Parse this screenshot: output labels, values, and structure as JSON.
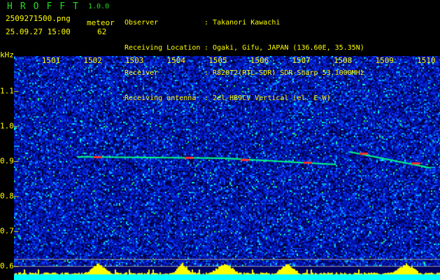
{
  "header": {
    "app": "HROFFT",
    "version": "1.0.0",
    "file": "2509271500.png",
    "datetime": "25.09.27 15:00",
    "meteor_label": "meteor",
    "meteor_count": "62"
  },
  "info": [
    {
      "label": "Observer",
      "value": "Takanori Kawachi"
    },
    {
      "label": "Receiving Location",
      "value": "Ogaki, Gifu, JAPAN (136.60E, 35.35N)"
    },
    {
      "label": "Receiver",
      "value": "R820T2(RTL-SDR) SDR-Sharp 53.1000MHz"
    },
    {
      "label": "Receiving antenna",
      "value": "2el-HB9CV Vertical (el. E-W)"
    }
  ],
  "chart_data": {
    "type": "heatmap",
    "ylabel": "kHz",
    "x_ticks": [
      "1501",
      "1502",
      "1503",
      "1504",
      "1505",
      "1506",
      "1507",
      "1508",
      "1509",
      "1510"
    ],
    "y_ticks": [
      "1.1",
      "1.0",
      "0.9",
      "0.8",
      "0.7",
      "0.6"
    ],
    "ylim": [
      0.56,
      1.2
    ],
    "colors": {
      "background": "#000080",
      "signal": "#ff2020",
      "histogram": "#ffff00",
      "baseline": "#00ffff"
    }
  }
}
